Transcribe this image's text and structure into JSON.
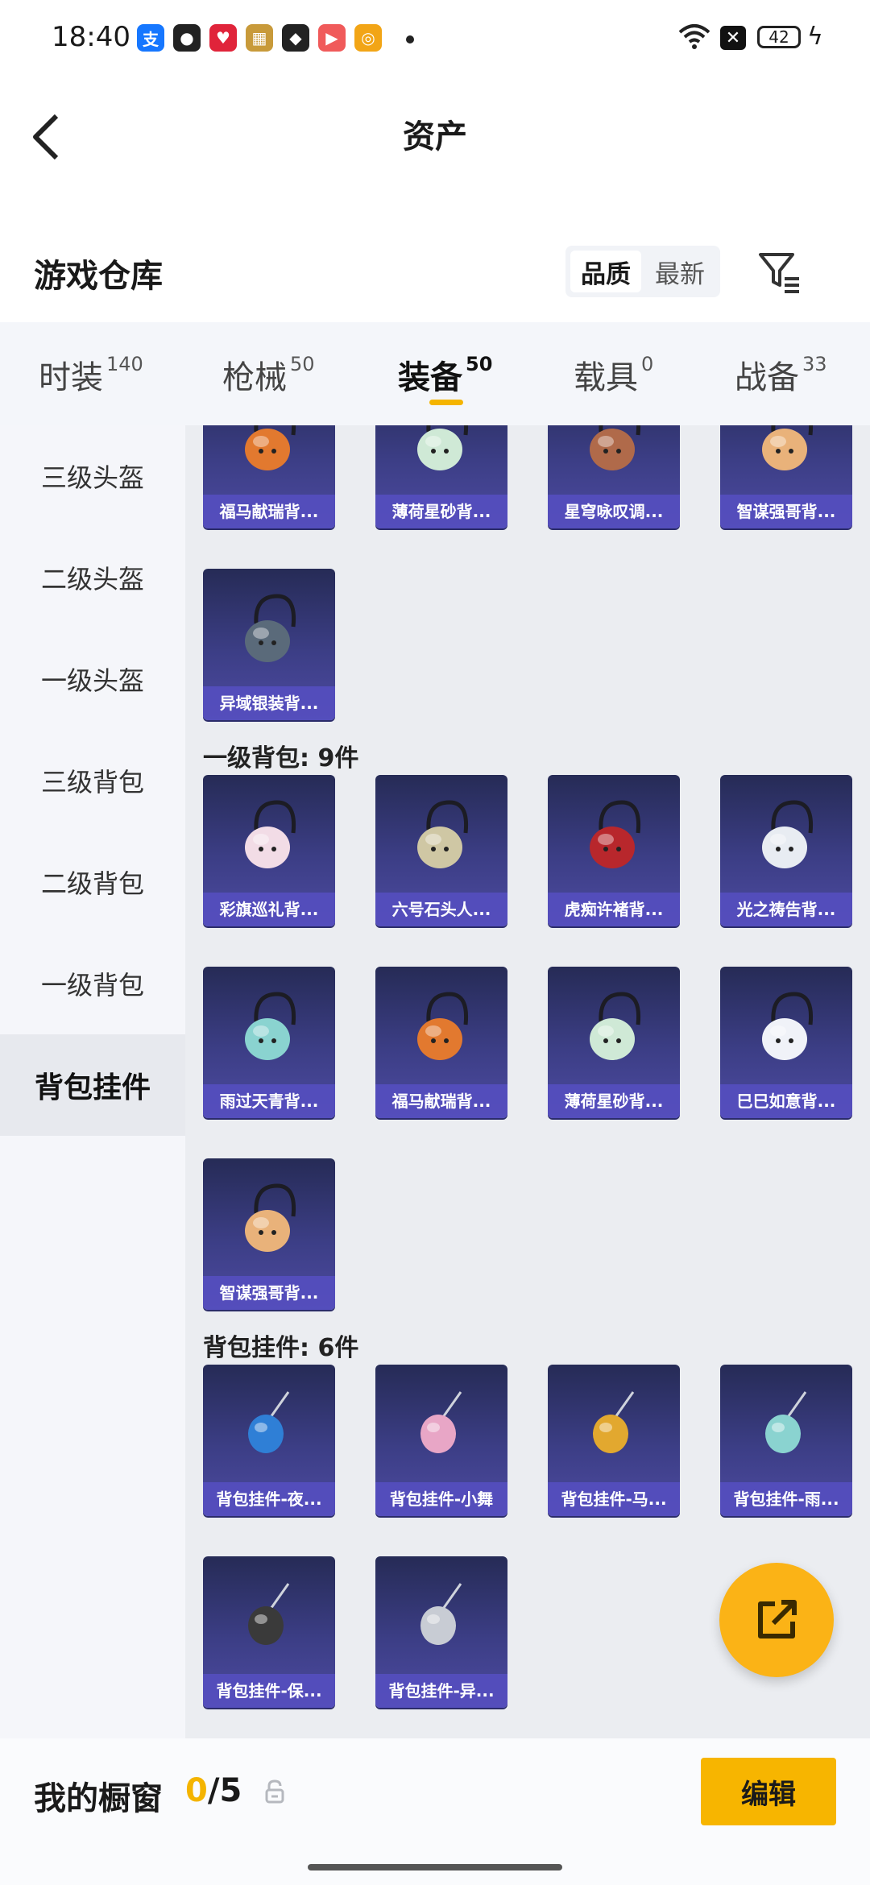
{
  "status_bar": {
    "time": "18:40",
    "battery": "42",
    "app_icons": [
      {
        "name": "alipay-icon",
        "glyph": "支",
        "color": "#1677ff"
      },
      {
        "name": "wechat-icon",
        "glyph": "●",
        "color": "#222222"
      },
      {
        "name": "heart-app-icon",
        "glyph": "♥",
        "color": "#e0243a"
      },
      {
        "name": "game-app-icon",
        "glyph": "▦",
        "color": "#c89a3a"
      },
      {
        "name": "shield-app-icon",
        "glyph": "◆",
        "color": "#222222"
      },
      {
        "name": "play-app-icon",
        "glyph": "▶",
        "color": "#f05a5a"
      },
      {
        "name": "target-app-icon",
        "glyph": "◎",
        "color": "#f2a516"
      }
    ]
  },
  "header": {
    "title": "资产"
  },
  "warehouse": {
    "title": "游戏仓库",
    "sort_quality": "品质",
    "sort_newest": "最新"
  },
  "tabs": [
    {
      "label": "时装",
      "count": "140",
      "active": false
    },
    {
      "label": "枪械",
      "count": "50",
      "active": false
    },
    {
      "label": "装备",
      "count": "50",
      "active": true
    },
    {
      "label": "载具",
      "count": "0",
      "active": false
    },
    {
      "label": "战备",
      "count": "33",
      "active": false
    }
  ],
  "sidebar": [
    {
      "label": "三级头盔",
      "active": false
    },
    {
      "label": "二级头盔",
      "active": false
    },
    {
      "label": "一级头盔",
      "active": false
    },
    {
      "label": "三级背包",
      "active": false
    },
    {
      "label": "二级背包",
      "active": false
    },
    {
      "label": "一级背包",
      "active": false
    },
    {
      "label": "背包挂件",
      "active": true
    }
  ],
  "sections": [
    {
      "title": "",
      "items": [
        {
          "label": "福马献瑞背...",
          "icon": "horse-backpack",
          "color": "#e2792f"
        },
        {
          "label": "薄荷星砂背...",
          "icon": "mint-backpack",
          "color": "#cfe9d6"
        },
        {
          "label": "星穹咏叹调...",
          "icon": "star-backpack",
          "color": "#b06a4a"
        },
        {
          "label": "智谋强哥背...",
          "icon": "face-backpack",
          "color": "#e9b27a"
        },
        {
          "label": "异域银装背...",
          "icon": "tech-backpack",
          "color": "#5a6a7a"
        }
      ]
    },
    {
      "title": "一级背包: 9件",
      "items": [
        {
          "label": "彩旗巡礼背...",
          "icon": "flag-backpack",
          "color": "#f2dce6"
        },
        {
          "label": "六号石头人...",
          "icon": "stone-backpack",
          "color": "#cfc7a4"
        },
        {
          "label": "虎痴许褚背...",
          "icon": "tiger-backpack",
          "color": "#b8272c"
        },
        {
          "label": "光之祷告背...",
          "icon": "light-backpack",
          "color": "#e8ecf2"
        },
        {
          "label": "雨过天青背...",
          "icon": "celadon-backpack",
          "color": "#8ad3d0"
        },
        {
          "label": "福马献瑞背...",
          "icon": "horse-backpack",
          "color": "#e2792f"
        },
        {
          "label": "薄荷星砂背...",
          "icon": "mint-backpack",
          "color": "#cfe9d6"
        },
        {
          "label": "巳巳如意背...",
          "icon": "snake-backpack",
          "color": "#f0f2f8"
        },
        {
          "label": "智谋强哥背...",
          "icon": "face-backpack",
          "color": "#e9b27a"
        }
      ]
    },
    {
      "title": "背包挂件: 6件",
      "items": [
        {
          "label": "背包挂件-夜...",
          "icon": "beetle-charm",
          "color": "#2f7fd6"
        },
        {
          "label": "背包挂件-小舞",
          "icon": "shoe-charm",
          "color": "#e8a6c6"
        },
        {
          "label": "背包挂件-马...",
          "icon": "horse-charm",
          "color": "#e2a82f"
        },
        {
          "label": "背包挂件-雨...",
          "icon": "sword-charm",
          "color": "#8ad3d0"
        },
        {
          "label": "背包挂件-保...",
          "icon": "radio-charm",
          "color": "#3a3a3a"
        },
        {
          "label": "背包挂件-异...",
          "icon": "wing-charm",
          "color": "#c8ccd4"
        }
      ]
    }
  ],
  "showcase": {
    "label": "我的橱窗",
    "current": "0",
    "total": "/5",
    "edit_label": "编辑"
  },
  "colors": {
    "accent": "#f4b400",
    "card_top": "#262b56",
    "card_label": "#554ebe"
  }
}
